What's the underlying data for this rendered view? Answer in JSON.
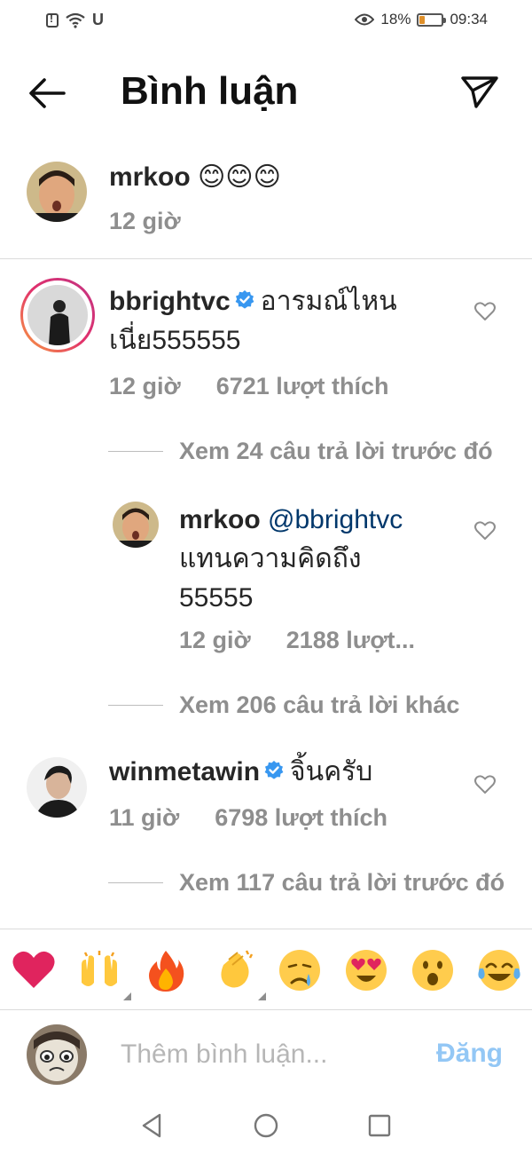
{
  "status_bar": {
    "battery": "18%",
    "time": "09:34",
    "carrier_icon": "u-icon",
    "battery_level": 0.18
  },
  "header": {
    "title": "Bình luận"
  },
  "caption": {
    "username": "mrkoo",
    "text": "😊😊😊",
    "time": "12 giờ"
  },
  "comments": [
    {
      "username": "bbrightvc",
      "verified": true,
      "text_line1": "อารมณ์ไหน",
      "text_line2": "เนี่ย555555",
      "time": "12 giờ",
      "likes": "6721 lượt thích",
      "view_replies": "Xem 24 câu trả lời trước đó",
      "reply": {
        "username": "mrkoo",
        "mention": "@bbrightvc",
        "text_line1": "แทนความคิดถึง",
        "text_line2": "55555",
        "time": "12 giờ",
        "likes": "2188 lượt..."
      },
      "view_more": "Xem 206 câu trả lời khác"
    },
    {
      "username": "winmetawin",
      "verified": true,
      "text": "จิ้นครับ",
      "time": "11 giờ",
      "likes": "6798 lượt thích",
      "view_replies": "Xem 117 câu trả lời trước đó"
    }
  ],
  "emoji_bar": [
    "❤️",
    "🙌",
    "🔥",
    "👏",
    "😢",
    "😍",
    "😮",
    "😂"
  ],
  "comment_bar": {
    "placeholder": "Thêm bình luận...",
    "post_label": "Đăng"
  },
  "colors": {
    "link_blue": "#00376b",
    "post_blue": "#93c7f5",
    "meta_gray": "#8e8e8e",
    "verified_blue": "#3897f0"
  }
}
